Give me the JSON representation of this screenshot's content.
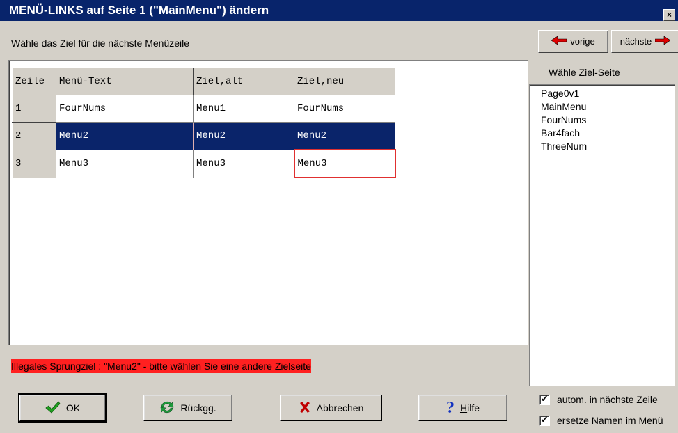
{
  "window": {
    "title": "MENÜ-LINKS auf Seite 1 (\"MainMenu\") ändern",
    "close_glyph": "×"
  },
  "instruction": "Wähle das Ziel  für die nächste Menüzeile",
  "nav": {
    "prev_label": "vorige",
    "next_label": "nächste"
  },
  "table": {
    "headers": [
      "Zeile",
      "Menü-Text",
      "Ziel,alt",
      "Ziel,neu"
    ],
    "rows": [
      {
        "num": "1",
        "text": "FourNums",
        "alt": "Menu1",
        "neu": "FourNums"
      },
      {
        "num": "2",
        "text": "Menu2",
        "alt": "Menu2",
        "neu": "Menu2"
      },
      {
        "num": "3",
        "text": "Menu3",
        "alt": "Menu3",
        "neu": "Menu3"
      }
    ],
    "selected_row": "2"
  },
  "target": {
    "label": "Wähle Ziel-Seite",
    "items": [
      "Page0v1",
      "MainMenu",
      "FourNums",
      "Bar4fach",
      "ThreeNum"
    ],
    "focused_item": "FourNums"
  },
  "error_message": "Illegales Sprungziel : \"Menu2\"  -  bitte wählen Sie eine andere Zielseite",
  "buttons": {
    "ok": "OK",
    "undo": "Rückgg.",
    "cancel": "Abbrechen",
    "help_prefix": "",
    "help_hotkey": "H",
    "help_rest": "ilfe"
  },
  "options": {
    "auto_next": {
      "label": "autom. in nächste Zeile",
      "checked": true
    },
    "replace_names": {
      "label": "ersetze Namen im Menü",
      "checked": true
    }
  },
  "colors": {
    "title_bar": "#08246b",
    "selection": "#0a246a",
    "error_bg": "#ff2020",
    "ok_check": "#20a020",
    "undo_icon": "#1f9a3c",
    "cancel_icon": "#c00000",
    "help_icon": "#1030c0",
    "arrow": "#e00000"
  }
}
